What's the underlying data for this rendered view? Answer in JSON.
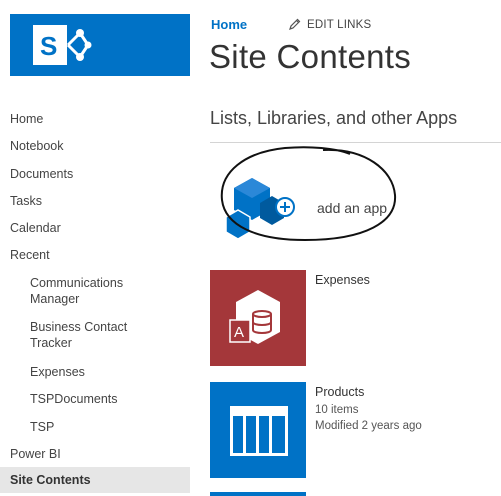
{
  "logo": {
    "icon": "sharepoint-logo-icon",
    "letter": "S",
    "color": "#0072c6"
  },
  "nav": {
    "items": [
      {
        "label": "Home"
      },
      {
        "label": "Notebook"
      },
      {
        "label": "Documents"
      },
      {
        "label": "Tasks"
      },
      {
        "label": "Calendar"
      },
      {
        "label": "Recent"
      }
    ],
    "recent": [
      {
        "label": "Communications Manager"
      },
      {
        "label": "Business Contact Tracker"
      },
      {
        "label": "Expenses"
      },
      {
        "label": "TSPDocuments"
      },
      {
        "label": "TSP"
      }
    ],
    "power_bi": "Power BI",
    "site_contents": "Site Contents"
  },
  "header": {
    "breadcrumb_home": "Home",
    "edit_links": "EDIT LINKS",
    "page_title": "Site Contents"
  },
  "section": {
    "title": "Lists, Libraries, and other Apps"
  },
  "add_app": {
    "label": "add an app"
  },
  "apps": [
    {
      "name": "Expenses",
      "icon": "access-database-icon",
      "color": "#a4373a"
    },
    {
      "name": "Products",
      "icon": "list-table-icon",
      "color": "#0072c6",
      "items": "10 items",
      "modified": "Modified 2 years ago"
    }
  ]
}
